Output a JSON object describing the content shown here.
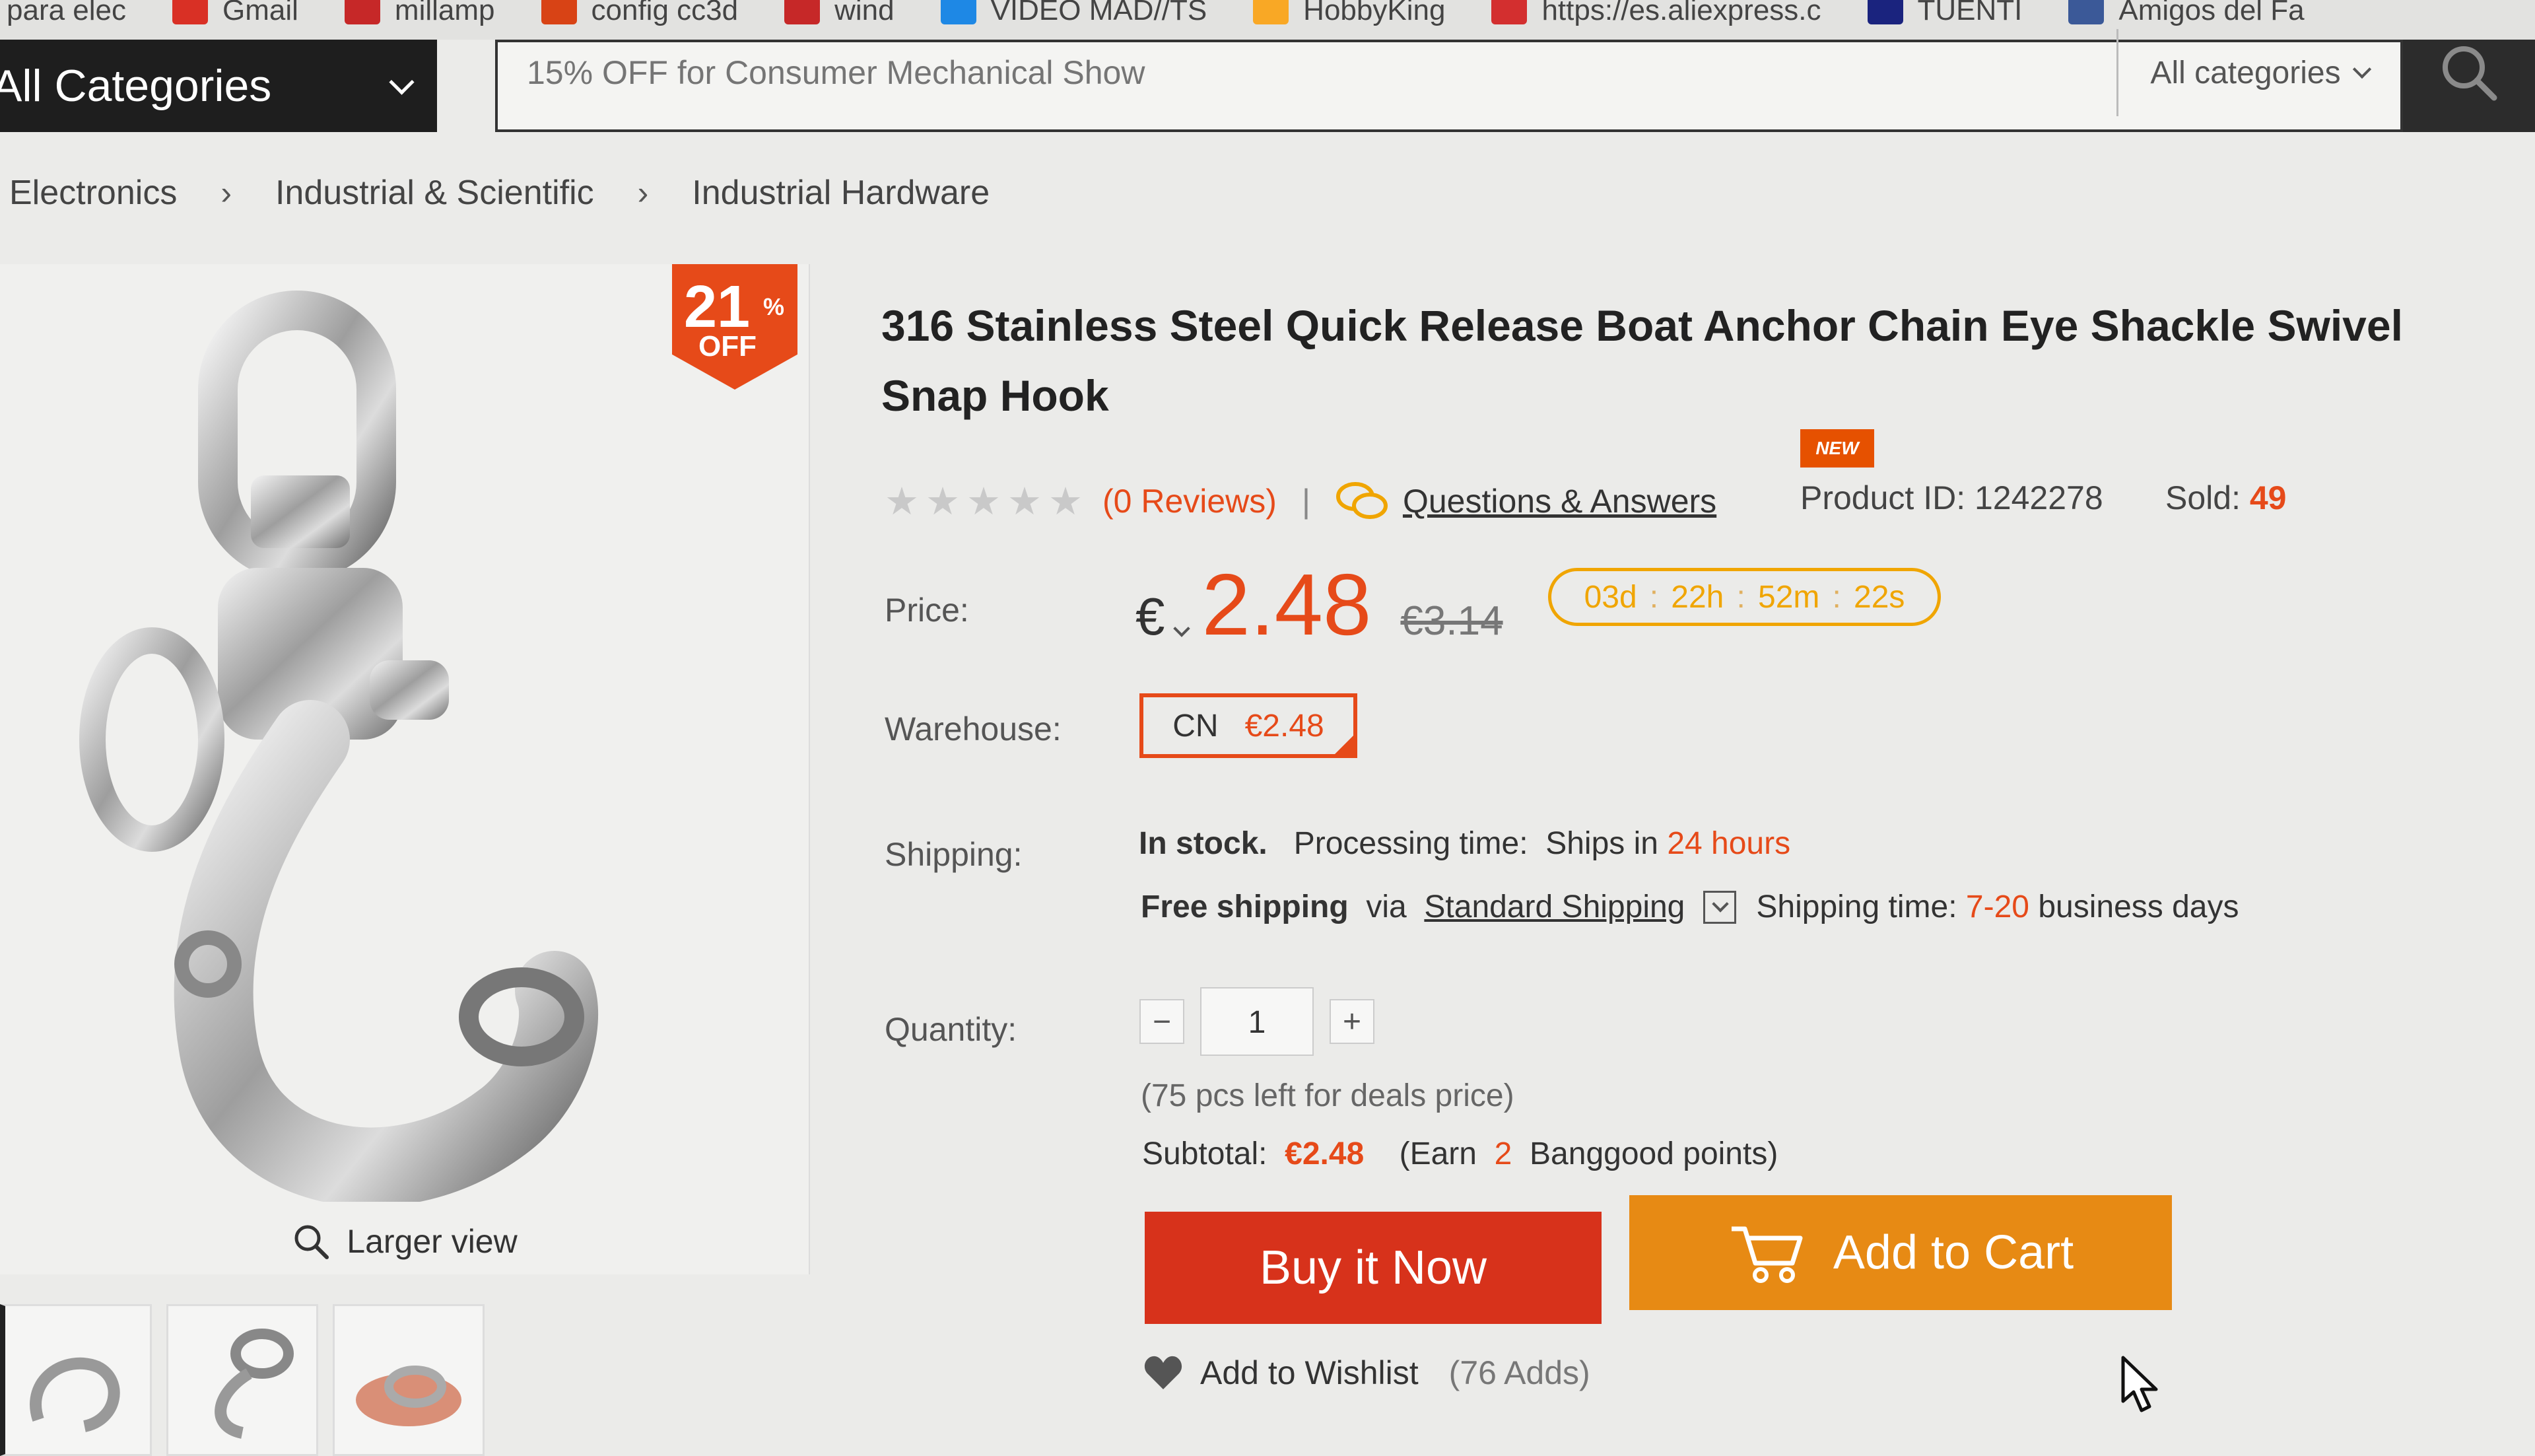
{
  "bookmarks": [
    {
      "label": "para elec",
      "color": "#3b6cc7"
    },
    {
      "label": "Gmail",
      "color": "#d93025"
    },
    {
      "label": "millamp",
      "color": "#c62828"
    },
    {
      "label": "config cc3d",
      "color": "#d84315"
    },
    {
      "label": "wind",
      "color": "#c62828"
    },
    {
      "label": "VIDEO MAD//TS",
      "color": "#1e88e5"
    },
    {
      "label": "HobbyKing",
      "color": "#f9a825"
    },
    {
      "label": "https://es.aliexpress.c",
      "color": "#d32f2f"
    },
    {
      "label": "TUENTI",
      "color": "#1a237e"
    },
    {
      "label": "Amigos del Fa",
      "color": "#3b5998"
    }
  ],
  "header": {
    "categories_label": "All Categories",
    "search_placeholder": "15% OFF for Consumer Mechanical Show",
    "search_category": "All categories"
  },
  "breadcrumb": [
    "Electronics",
    "Industrial & Scientific",
    "Industrial Hardware"
  ],
  "gallery": {
    "discount_number": "21",
    "discount_percent": "%",
    "discount_off": "OFF",
    "larger_view": "Larger view"
  },
  "product": {
    "title": "316 Stainless Steel Quick Release Boat Anchor Chain Eye Shackle Swivel Snap Hook",
    "new_tag": "NEW",
    "reviews": "(0 Reviews)",
    "qa": "Questions & Answers",
    "product_id": "Product ID: 1242278",
    "sold_label": "Sold:",
    "sold_value": "49",
    "rating": 0
  },
  "labels": {
    "price": "Price:",
    "warehouse": "Warehouse:",
    "shipping": "Shipping:",
    "quantity": "Quantity:"
  },
  "price": {
    "currency": "€",
    "current": "2.48",
    "old": "€3.14",
    "timer": [
      "03d",
      "22h",
      "52m",
      "22s"
    ]
  },
  "warehouse": {
    "code": "CN",
    "price": "€2.48"
  },
  "shipping": {
    "in_stock": "In stock.",
    "processing": "Processing time:",
    "ships_in": "Ships in",
    "hours": "24 hours",
    "free": "Free shipping",
    "via": "via",
    "method": "Standard Shipping",
    "time_label": "Shipping time:",
    "time_range": "7-20",
    "time_unit": "business days"
  },
  "quantity": {
    "minus": "−",
    "value": "1",
    "plus": "+",
    "deals_left": "(75 pcs left for deals price)"
  },
  "subtotal": {
    "label": "Subtotal:",
    "value": "€2.48",
    "earn_prefix": "(Earn",
    "points": "2",
    "earn_suffix": "Banggood points)"
  },
  "actions": {
    "buy": "Buy it Now",
    "cart": "Add to Cart",
    "wishlist": "Add to Wishlist",
    "wishlist_count": "(76 Adds)"
  }
}
